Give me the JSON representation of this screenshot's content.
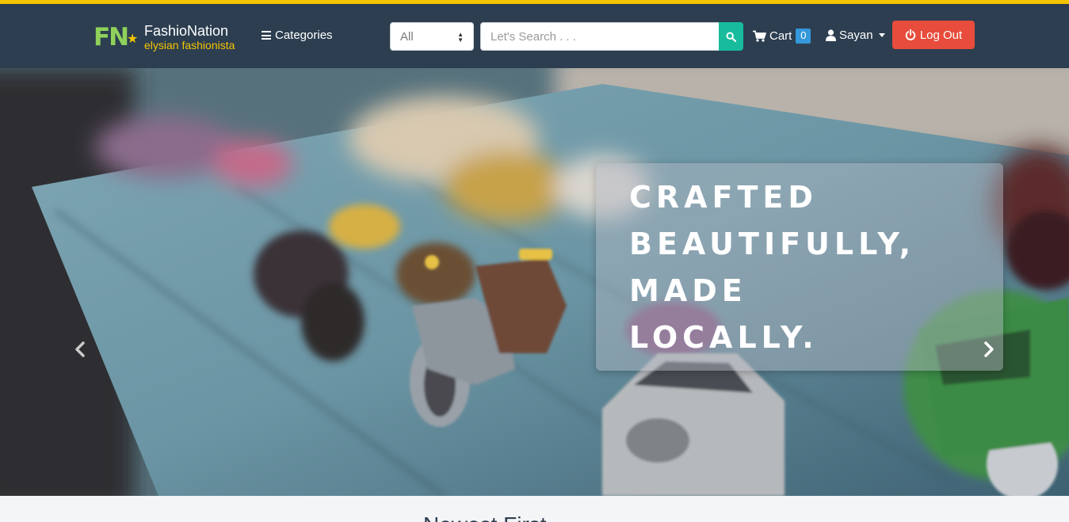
{
  "brand": {
    "logo": "FN",
    "name": "FashioNation",
    "tagline": "elysian fashionista",
    "colors": {
      "logo": "#8fd15a",
      "star": "#f5c400"
    }
  },
  "nav": {
    "categories_label": "Categories",
    "categories_icon": "menu-bars-icon",
    "search": {
      "category_selected": "All",
      "placeholder": "Let's Search . . .",
      "value": "",
      "button_icon": "search-icon"
    },
    "cart": {
      "label": "Cart",
      "count": "0",
      "icon": "cart-icon"
    },
    "user": {
      "name": "Sayan",
      "icon": "user-icon"
    },
    "logout": {
      "label": "Log Out",
      "icon": "power-icon"
    }
  },
  "carousel": {
    "caption_lines": [
      "CRAFTED",
      "BEAUTIFULLY,",
      "MADE",
      "LOCALLY."
    ],
    "prev_icon": "chevron-left-icon",
    "next_icon": "chevron-right-icon"
  },
  "section": {
    "heading": "Newest First"
  },
  "colors": {
    "navbar": "#2c3e50",
    "accent_bar": "#f5c400",
    "search_button": "#18bc9c",
    "cart_badge": "#3498db",
    "logout_button": "#e74c3c"
  }
}
